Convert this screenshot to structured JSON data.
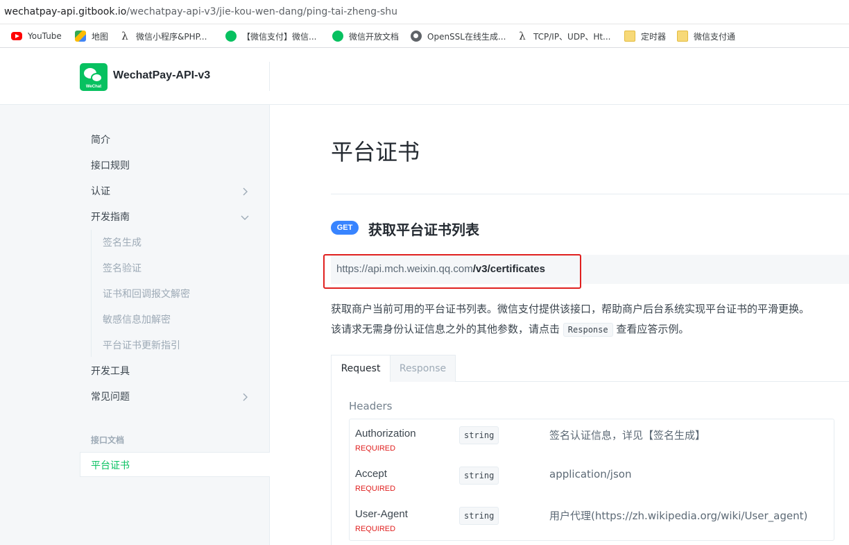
{
  "browser": {
    "url_host": "wechatpay-api.gitbook.io",
    "url_path": "/wechatpay-api-v3/jie-kou-wen-dang/ping-tai-zheng-shu",
    "bookmarks": [
      {
        "label": "YouTube",
        "icon": "youtube-icon"
      },
      {
        "label": "地图",
        "icon": "maps-icon"
      },
      {
        "label": "微信小程序&PHP...",
        "icon": "lambda-icon"
      },
      {
        "label": "【微信支付】微信...",
        "icon": "wechat-icon"
      },
      {
        "label": "微信开放文档",
        "icon": "wechat-icon"
      },
      {
        "label": "OpenSSL在线生成...",
        "icon": "globe-icon"
      },
      {
        "label": "TCP/IP、UDP、Ht...",
        "icon": "lambda-icon"
      },
      {
        "label": "定时器",
        "icon": "folder-icon"
      },
      {
        "label": "微信支付通",
        "icon": "folder-icon"
      }
    ]
  },
  "header": {
    "logo_text": "WeChat",
    "title": "WechatPay-API-v3"
  },
  "sidebar": {
    "items": [
      {
        "label": "简介"
      },
      {
        "label": "接口规则"
      },
      {
        "label": "认证",
        "chevron": "right"
      },
      {
        "label": "开发指南",
        "chevron": "down"
      },
      {
        "label": "签名生成"
      },
      {
        "label": "签名验证"
      },
      {
        "label": "证书和回调报文解密"
      },
      {
        "label": "敏感信息加解密"
      },
      {
        "label": "平台证书更新指引"
      },
      {
        "label": "开发工具"
      },
      {
        "label": "常见问题",
        "chevron": "right"
      }
    ],
    "section_label": "接口文档",
    "active_item": "平台证书"
  },
  "main": {
    "page_title": "平台证书",
    "method": "GET",
    "endpoint_title": "获取平台证书列表",
    "url_base": "https://api.mch.weixin.qq.com",
    "url_path": "/v3/certificates",
    "desc_line1": "获取商户当前可用的平台证书列表。微信支付提供该接口，帮助商户后台系统实现平台证书的平滑更换。",
    "desc_line2_pre": "该请求无需身份认证信息之外的其他参数，请点击",
    "desc_code": "Response",
    "desc_line2_post": "查看应答示例。",
    "tabs": [
      "Request",
      "Response"
    ],
    "headers_label": "Headers",
    "headers": [
      {
        "name": "Authorization",
        "required": "REQUIRED",
        "type": "string",
        "desc": "签名认证信息，详见【签名生成】"
      },
      {
        "name": "Accept",
        "required": "REQUIRED",
        "type": "string",
        "desc": "application/json"
      },
      {
        "name": "User-Agent",
        "required": "REQUIRED",
        "type": "string",
        "desc": "用户代理(https://zh.wikipedia.org/wiki/User_agent)"
      }
    ]
  },
  "colors": {
    "accent": "#07c160",
    "get_badge": "#3884ff",
    "required": "#e0201f",
    "highlight_box": "#e0201f"
  }
}
